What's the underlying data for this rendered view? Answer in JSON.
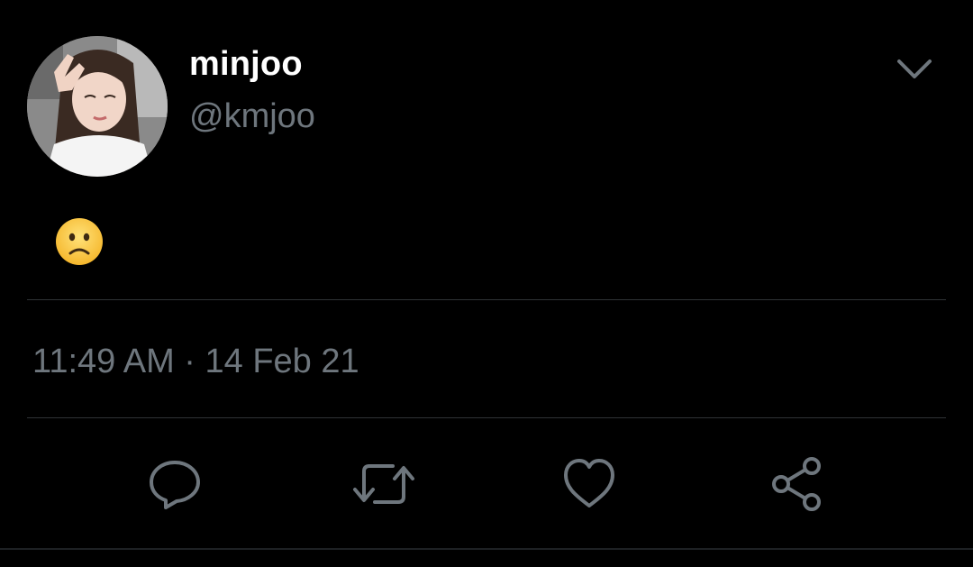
{
  "author": {
    "display_name": "minjoo",
    "handle": "@kmjoo"
  },
  "tweet": {
    "text": "🙁",
    "emoji_name": "slightly-frowning-face",
    "timestamp": "11:49 AM · 14 Feb 21"
  },
  "icons": {
    "more": "chevron-down-icon",
    "reply": "reply-icon",
    "retweet": "retweet-icon",
    "like": "heart-icon",
    "share": "share-icon"
  },
  "colors": {
    "background": "#000000",
    "primary_text": "#ffffff",
    "secondary_text": "#6e767d",
    "divider": "#2f3336",
    "icon": "#6e767d"
  }
}
